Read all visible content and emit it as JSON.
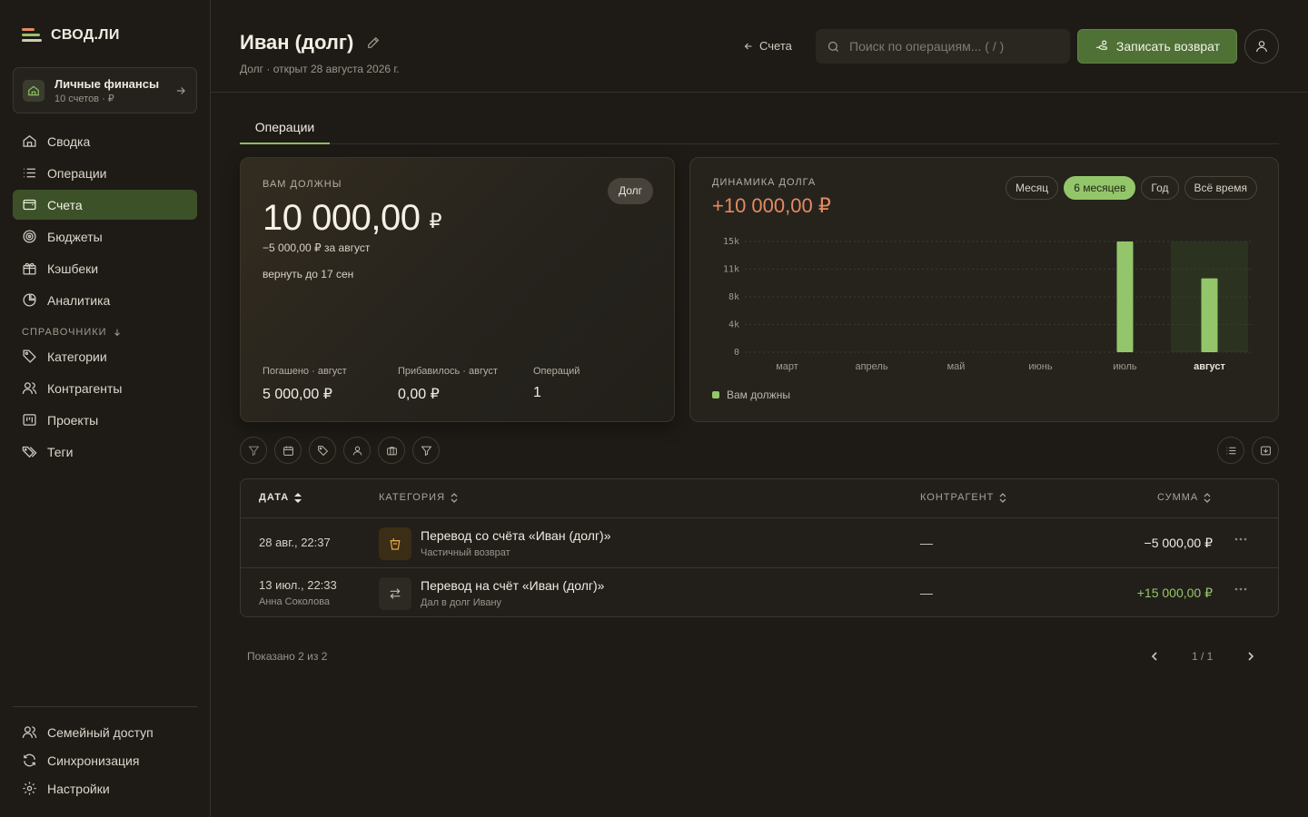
{
  "app": {
    "logo_text": "СВОД.ЛИ",
    "logo_colors": [
      "#e58a5f",
      "#93c66a",
      "#cfc9be"
    ]
  },
  "workspace": {
    "title": "Личные финансы",
    "subtitle": "10 счетов · ₽"
  },
  "nav": {
    "main": [
      {
        "label": "Сводка",
        "icon": "home-icon",
        "active": false
      },
      {
        "label": "Операции",
        "icon": "list-icon",
        "active": false
      },
      {
        "label": "Счета",
        "icon": "wallet-icon",
        "active": true
      },
      {
        "label": "Бюджеты",
        "icon": "target-icon",
        "active": false
      },
      {
        "label": "Кэшбеки",
        "icon": "gift-icon",
        "active": false
      },
      {
        "label": "Аналитика",
        "icon": "pie-chart-icon",
        "active": false
      }
    ],
    "group_label": "СПРАВОЧНИКИ",
    "refs": [
      {
        "label": "Категории",
        "icon": "tag-icon"
      },
      {
        "label": "Контрагенты",
        "icon": "users-icon"
      },
      {
        "label": "Проекты",
        "icon": "kanban-icon"
      },
      {
        "label": "Теги",
        "icon": "tags-icon"
      }
    ],
    "bottom": [
      {
        "label": "Семейный доступ",
        "icon": "family-icon"
      },
      {
        "label": "Синхронизация",
        "icon": "sync-icon"
      },
      {
        "label": "Настройки",
        "icon": "gear-icon"
      }
    ]
  },
  "header": {
    "title": "Иван (долг)",
    "subtitle": "Долг · открыт 28 августа 2026 г.",
    "back_label": "Счета",
    "search_placeholder": "Поиск по операциям... ( / )",
    "cta_label": "Записать возврат"
  },
  "tabs": [
    {
      "label": "Операции",
      "active": true
    }
  ],
  "balance": {
    "label": "ВАМ ДОЛЖНЫ",
    "badge": "Долг",
    "amount": "10 000,00",
    "currency": "₽",
    "delta": "−5 000,00 ₽ за август",
    "due": "вернуть до 17 сен",
    "stats": [
      {
        "label": "Погашено · август",
        "value": "5 000,00 ₽"
      },
      {
        "label": "Прибавилось · август",
        "value": "0,00 ₽"
      },
      {
        "label": "Операций",
        "value": "1"
      }
    ]
  },
  "chart_card": {
    "label": "ДИНАМИКА ДОЛГА",
    "total": "+10 000,00 ₽",
    "periods": [
      {
        "label": "Месяц",
        "active": false
      },
      {
        "label": "6 месяцев",
        "active": true
      },
      {
        "label": "Год",
        "active": false
      },
      {
        "label": "Всё время",
        "active": false
      }
    ]
  },
  "chart_data": {
    "type": "bar",
    "categories": [
      "март",
      "апрель",
      "май",
      "июнь",
      "июль",
      "август"
    ],
    "series": [
      {
        "name": "Вам должны",
        "values": [
          0,
          0,
          0,
          0,
          15000,
          10000
        ],
        "color": "#93c66a"
      }
    ],
    "yticks": [
      "15k",
      "11k",
      "8k",
      "4k",
      "0"
    ],
    "ylim": [
      0,
      15000
    ],
    "highlight_category": "август",
    "grid": true,
    "legend": "bottom-left"
  },
  "table": {
    "columns": [
      {
        "label": "ДАТА",
        "sorted": true
      },
      {
        "label": "КАТЕГОРИЯ",
        "sorted": false
      },
      {
        "label": "КОНТРАГЕНТ",
        "sorted": false
      },
      {
        "label": "СУММА",
        "sorted": false
      }
    ],
    "rows": [
      {
        "date": "28 авг., 22:37",
        "who": "",
        "icon": "cup-icon",
        "title": "Перевод со счёта «Иван (долг)»",
        "subtitle": "Частичный возврат",
        "counterparty": "—",
        "amount": "−5 000,00 ₽",
        "amount_color": "#f0ebe1"
      },
      {
        "date": "13 июл., 22:33",
        "who": "Анна Соколова",
        "icon": "transfer-icon",
        "title": "Перевод на счёт «Иван (долг)»",
        "subtitle": "Дал в долг Ивану",
        "counterparty": "—",
        "amount": "+15 000,00 ₽",
        "amount_color": "#93c66a"
      }
    ],
    "shown_text": "Показано 2 из 2",
    "page_text": "1 / 1"
  }
}
